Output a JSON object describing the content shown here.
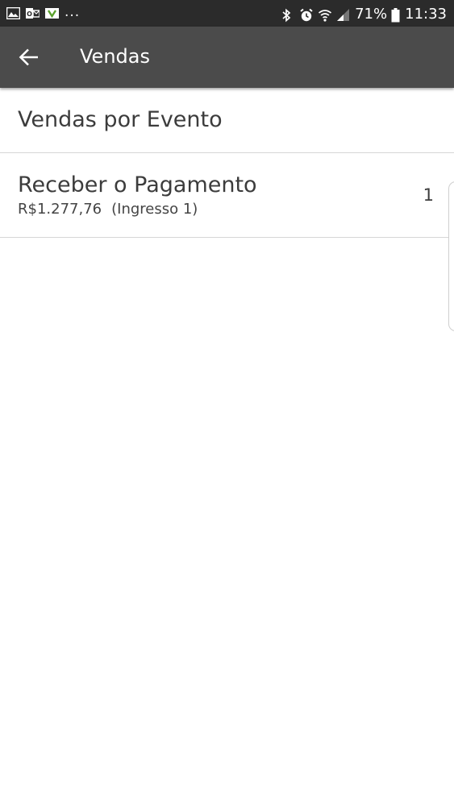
{
  "status_bar": {
    "notification_icons": [
      "gallery-icon",
      "outlook-icon",
      "vivo-icon"
    ],
    "more_indicator": "...",
    "system_icons": [
      "bluetooth-icon",
      "alarm-icon",
      "wifi-icon",
      "signal-icon"
    ],
    "battery_percent": "71%",
    "time": "11:33"
  },
  "app_bar": {
    "back_icon": "arrow-left-icon",
    "title": "Vendas"
  },
  "section": {
    "header": "Vendas por Evento"
  },
  "items": [
    {
      "title": "Receber o Pagamento",
      "amount": "R$1.277,76",
      "detail": "(Ingresso 1)",
      "count": "1"
    }
  ],
  "colors": {
    "status_bar_bg": "#2b2b2b",
    "app_bar_bg": "#4b4b4b",
    "text_primary": "#3c3c3c",
    "divider": "#d6d6d6"
  }
}
